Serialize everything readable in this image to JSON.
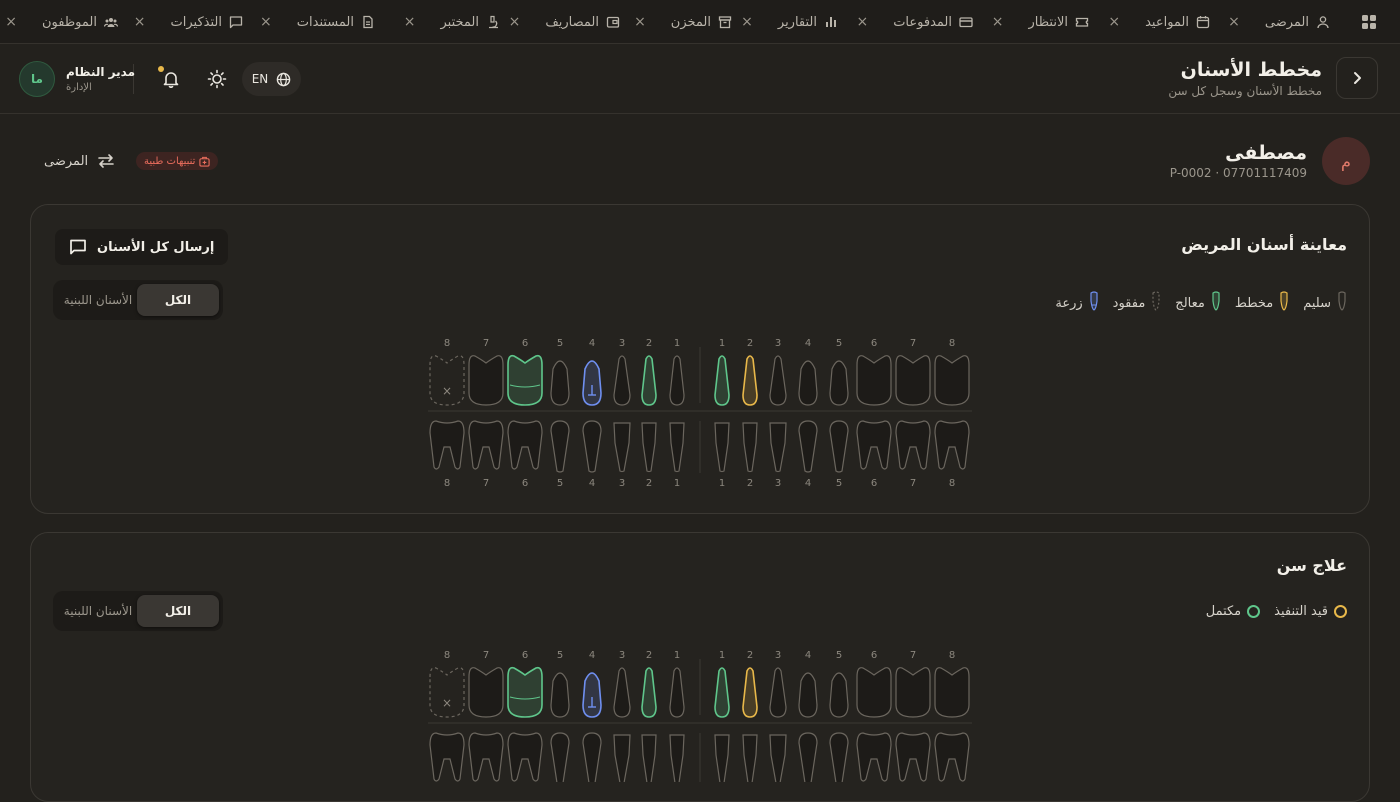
{
  "tabs": [
    {
      "label": "المرضى",
      "icon": "user-icon"
    },
    {
      "label": "المواعيد",
      "icon": "calendar-icon"
    },
    {
      "label": "الانتظار",
      "icon": "ticket-icon"
    },
    {
      "label": "المدفوعات",
      "icon": "credit-card-icon"
    },
    {
      "label": "التقارير",
      "icon": "bar-chart-icon"
    },
    {
      "label": "المخزن",
      "icon": "archive-icon"
    },
    {
      "label": "المصاريف",
      "icon": "wallet-icon"
    },
    {
      "label": "المختبر",
      "icon": "microscope-icon"
    },
    {
      "label": "المستندات",
      "icon": "document-icon"
    },
    {
      "label": "التذكيرات",
      "icon": "message-icon"
    },
    {
      "label": "الموظفون",
      "icon": "users-icon"
    }
  ],
  "tab_close": "×",
  "header": {
    "title": "مخطط الأسنان",
    "subtitle": "مخطط الأسنان وسجل كل سن",
    "lang": "EN",
    "user_name": "مدير النظام",
    "user_role": "الإدارة",
    "user_initials": "ما"
  },
  "patient": {
    "initial": "م",
    "name": "مصطفى",
    "meta": "P-0002 · 07701117409",
    "alerts_label": "تنبيهات طبية",
    "patients_link": "المرضى"
  },
  "exam_card": {
    "title": "معاينة أسنان المريض",
    "send_all": "إرسال كل الأسنان",
    "seg_all": "الكل",
    "seg_primary": "الأسنان اللبنية",
    "legend": [
      {
        "label": "سليم",
        "status": "healthy"
      },
      {
        "label": "مخطط",
        "status": "planned"
      },
      {
        "label": "معالج",
        "status": "treated"
      },
      {
        "label": "مفقود",
        "status": "missing"
      },
      {
        "label": "زرعة",
        "status": "implant"
      }
    ]
  },
  "treatment_card": {
    "title": "علاج سن",
    "seg_all": "الكل",
    "seg_primary": "الأسنان اللبنية",
    "legend": [
      {
        "label": "قيد التنفيذ",
        "color": "#e8b84a"
      },
      {
        "label": "مكتمل",
        "color": "#5fc68b"
      }
    ]
  },
  "colors": {
    "healthy": "#6b665e",
    "planned": "#e8b84a",
    "treated": "#5fc68b",
    "missing": "#6b665e",
    "implant": "#6f8ff0"
  },
  "tooth_numbers": [
    "8",
    "7",
    "6",
    "5",
    "4",
    "3",
    "2",
    "1",
    "1",
    "2",
    "3",
    "4",
    "5",
    "6",
    "7",
    "8"
  ],
  "upper_status": [
    "missing",
    "healthy",
    "treated",
    "healthy",
    "implant",
    "healthy",
    "treated",
    "healthy",
    "treated",
    "planned",
    "healthy",
    "healthy",
    "healthy",
    "healthy",
    "healthy",
    "healthy"
  ],
  "lower_status": [
    "healthy",
    "healthy",
    "healthy",
    "healthy",
    "healthy",
    "healthy",
    "healthy",
    "healthy",
    "healthy",
    "healthy",
    "healthy",
    "healthy",
    "healthy",
    "healthy",
    "healthy",
    "healthy"
  ]
}
